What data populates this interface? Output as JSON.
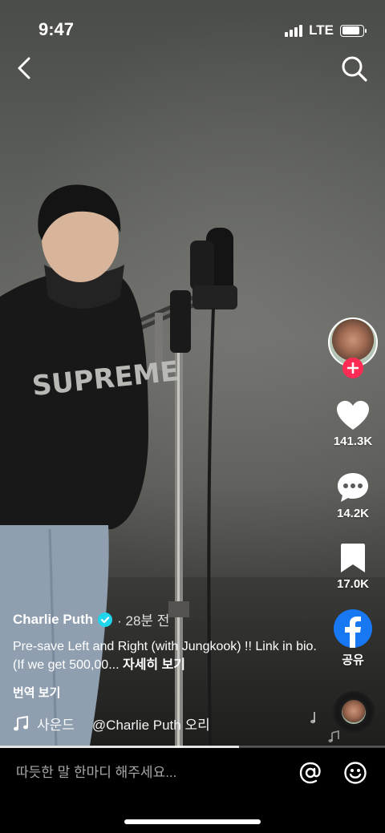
{
  "status_bar": {
    "time": "9:47",
    "network": "LTE",
    "battery_level": 0.85
  },
  "icons": {
    "back": "chevron-left-icon",
    "search": "search-icon",
    "like": "heart-icon",
    "comment": "comment-bubble-icon",
    "save": "bookmark-icon",
    "share": "facebook-icon",
    "sound": "music-note-icon",
    "mention": "at-sign-icon",
    "emoji": "smiley-icon"
  },
  "actions": {
    "like_count": "141.3K",
    "comment_count": "14.2K",
    "save_count": "17.0K",
    "share_label": "공유"
  },
  "post": {
    "author": "Charlie Puth",
    "time_ago": "· 28분 전",
    "description": "Pre-save Left and Right (with Jungkook) !! Link in bio. (If we get 500,00...",
    "more_label": "자세히 보기",
    "translate_label": "번역 보기"
  },
  "sound": {
    "label": "사운드",
    "author": "@Charlie Puth 오리"
  },
  "comment_box": {
    "placeholder": "따듯한 말 한마디 해주세요..."
  },
  "playback": {
    "progress": 0.62
  },
  "colors": {
    "follow_accent": "#fe2c55",
    "verified_blue": "#20d5ec",
    "facebook_blue": "#1877f2"
  }
}
